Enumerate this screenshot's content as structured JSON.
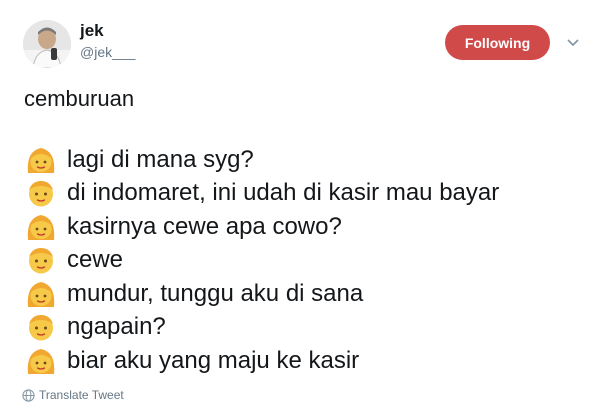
{
  "user": {
    "display_name": "jek",
    "handle": "@jek___"
  },
  "actions": {
    "follow_label": "Following",
    "more_icon": "chevron-down-icon"
  },
  "tweet": {
    "text": "cemburuan",
    "lines": [
      {
        "speaker": "girl",
        "text": "lagi di mana syg?"
      },
      {
        "speaker": "boy",
        "text": "di indomaret, ini udah di kasir mau bayar"
      },
      {
        "speaker": "girl",
        "text": "kasirnya cewe apa cowo?"
      },
      {
        "speaker": "boy",
        "text": "cewe"
      },
      {
        "speaker": "girl",
        "text": "mundur, tunggu aku di sana"
      },
      {
        "speaker": "boy",
        "text": "ngapain?"
      },
      {
        "speaker": "girl",
        "text": "biar aku yang maju ke kasir"
      }
    ]
  },
  "footer": {
    "translate_label": "Translate Tweet",
    "translate_icon": "globe-icon"
  },
  "colors": {
    "follow_button": "#d14a4a",
    "text_primary": "#14171a",
    "text_secondary": "#657786",
    "emoji_face": "#f7c948",
    "emoji_hair": "#f0a830"
  }
}
